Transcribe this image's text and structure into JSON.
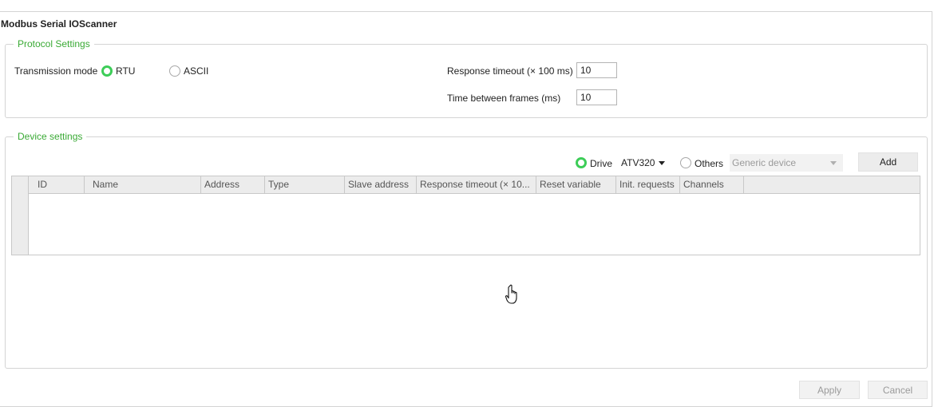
{
  "title": "Modbus Serial IOScanner",
  "protocol": {
    "legend": "Protocol Settings",
    "transmission_label": "Transmission mode",
    "rtu_label": "RTU",
    "ascii_label": "ASCII",
    "selected_mode": "RTU",
    "response_timeout_label": "Response timeout (× 100 ms)",
    "response_timeout_value": "10",
    "time_between_label": "Time between frames (ms)",
    "time_between_value": "10"
  },
  "device": {
    "legend": "Device settings",
    "drive_label": "Drive",
    "drive_selected": true,
    "drive_model": "ATV320",
    "others_label": "Others",
    "others_placeholder": "Generic device",
    "add_label": "Add",
    "columns": [
      "ID",
      "Name",
      "Address",
      "Type",
      "Slave address",
      "Response timeout (× 10...",
      "Reset variable",
      "Init. requests",
      "Channels"
    ],
    "rows": []
  },
  "footer": {
    "apply_label": "Apply",
    "cancel_label": "Cancel"
  },
  "colors": {
    "accent_green": "#3aaa35",
    "radio_green": "#3dcd58"
  },
  "icons": {
    "cursor": "hand-pointer-icon"
  }
}
